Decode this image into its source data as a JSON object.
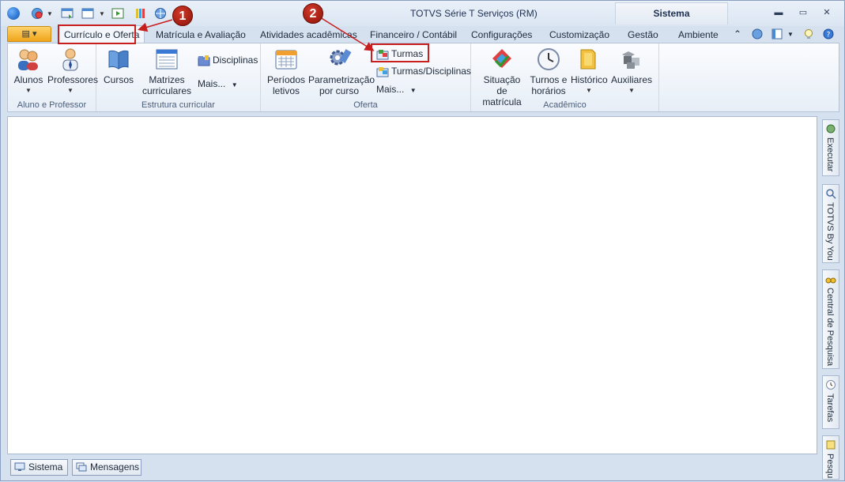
{
  "window": {
    "title": "TOTVS Série T Serviços (RM)",
    "context_tab": "Sistema"
  },
  "quick_access": [
    "app-logo",
    "globe-icon",
    "save-icon",
    "window-icon",
    "run-icon",
    "paint-icon",
    "web-icon"
  ],
  "tabs": [
    {
      "label": "Currículo e Oferta",
      "active": true
    },
    {
      "label": "Matrícula e Avaliação"
    },
    {
      "label": "Atividades acadêmicas"
    },
    {
      "label": "Financeiro / Contábil"
    },
    {
      "label": "Configurações"
    },
    {
      "label": "Customização"
    },
    {
      "label": "Gestão"
    },
    {
      "label": "Ambiente"
    }
  ],
  "ribbon": {
    "groups": {
      "aluno_professor": {
        "label": "Aluno e Professor",
        "alunos": "Alunos",
        "professores": "Professores"
      },
      "estrutura": {
        "label": "Estrutura curricular",
        "cursos": "Cursos",
        "matrizes_line1": "Matrizes",
        "matrizes_line2": "curriculares",
        "disciplinas": "Disciplinas",
        "mais": "Mais..."
      },
      "oferta": {
        "label": "Oferta",
        "periodos_line1": "Períodos",
        "periodos_line2": "letivos",
        "param_line1": "Parametrização",
        "param_line2": "por curso",
        "turmas": "Turmas",
        "turmas_disciplinas": "Turmas/Disciplinas",
        "mais": "Mais..."
      },
      "academico": {
        "label": "Acadêmico",
        "situacao_line1": "Situação de",
        "situacao_line2": "matrícula",
        "turnos_line1": "Turnos e",
        "turnos_line2": "horários",
        "historico": "Histórico",
        "auxiliares": "Auxiliares"
      }
    }
  },
  "dock": {
    "executar": "Executar",
    "by_you": "TOTVS By You",
    "central": "Central de Pesquisa",
    "tarefas": "Tarefas",
    "pesq": "Pesqu"
  },
  "bottom": {
    "sistema": "Sistema",
    "mensagens": "Mensagens"
  },
  "callouts": {
    "one": "1",
    "two": "2"
  },
  "colors": {
    "highlight": "#c81e1e",
    "file_button": "#f0a51c"
  }
}
